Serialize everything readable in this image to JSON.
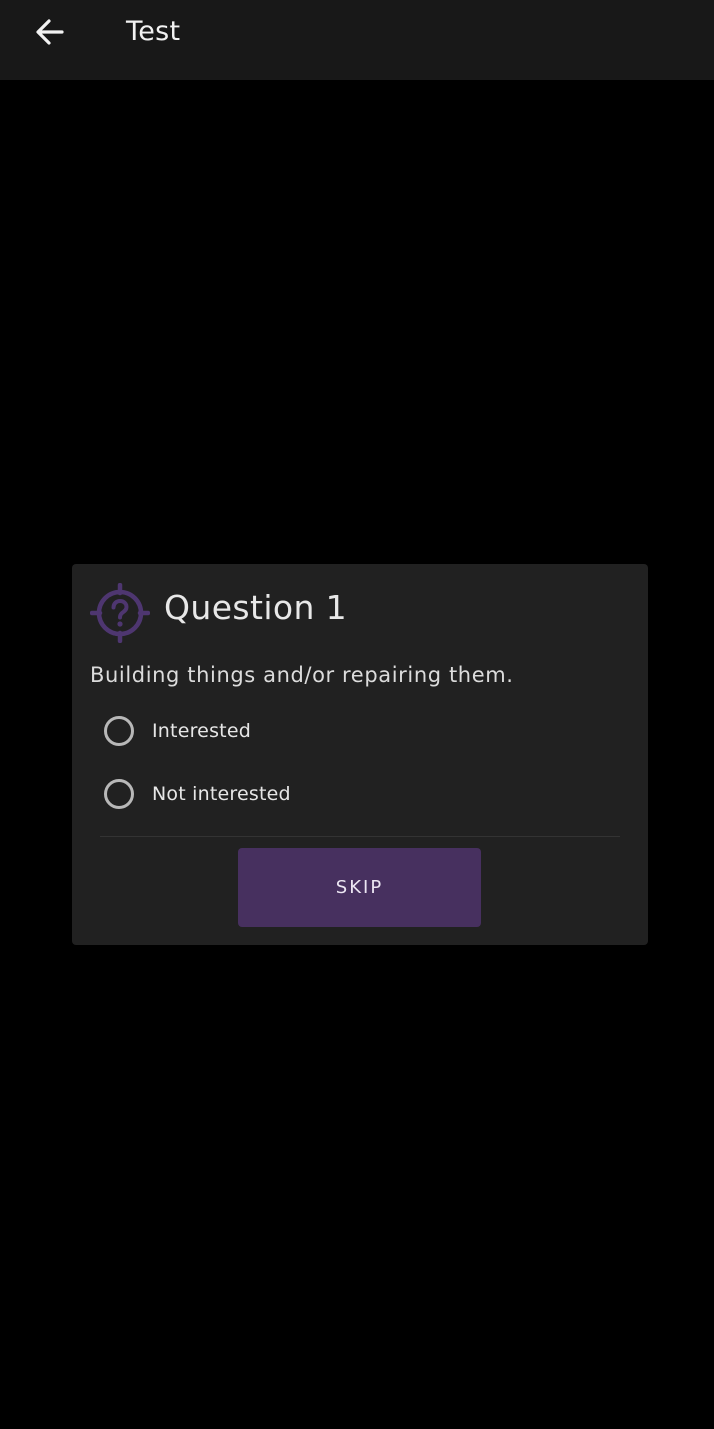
{
  "appbar": {
    "back_icon": "arrow-left-icon",
    "title": "Test"
  },
  "question": {
    "icon": "question-target-icon",
    "title": "Question 1",
    "text": "Building things and/or repairing them.",
    "options": [
      {
        "label": "Interested",
        "selected": false
      },
      {
        "label": "Not interested",
        "selected": false
      }
    ],
    "skip_label": "SKIP"
  },
  "colors": {
    "background": "#000000",
    "appbar": "#181818",
    "card": "#212121",
    "accent": "#47305f",
    "icon_accent": "#4e3670"
  }
}
